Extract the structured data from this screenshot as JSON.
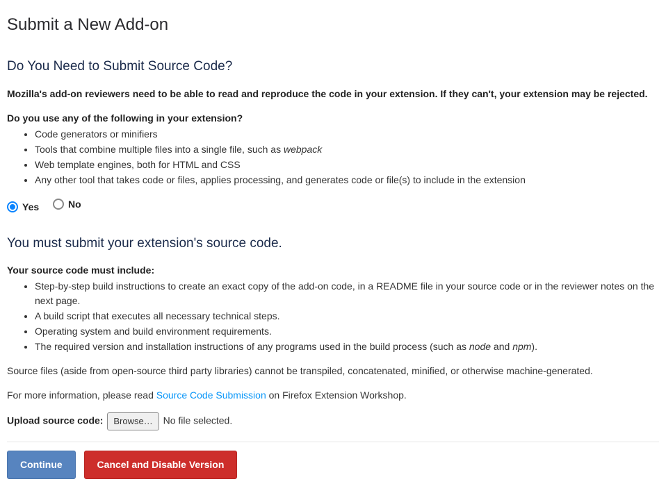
{
  "page_title": "Submit a New Add-on",
  "section1": {
    "heading": "Do You Need to Submit Source Code?",
    "intro": "Mozilla's add-on reviewers need to be able to read and reproduce the code in your extension. If they can't, your extension may be rejected.",
    "question": "Do you use any of the following in your extension?",
    "items": [
      "Code generators or minifiers",
      "Tools that combine multiple files into a single file, such as ",
      "Web template engines, both for HTML and CSS",
      "Any other tool that takes code or files, applies processing, and generates code or file(s) to include in the extension"
    ],
    "item1_em": "webpack"
  },
  "radio": {
    "yes": "Yes",
    "no": "No"
  },
  "section2": {
    "heading": "You must submit your extension's source code.",
    "must_include": "Your source code must include:",
    "items": [
      "Step-by-step build instructions to create an exact copy of the add-on code, in a README file in your source code or in the reviewer notes on the next page.",
      "A build script that executes all necessary technical steps.",
      "Operating system and build environment requirements."
    ],
    "item4_prefix": "The required version and installation instructions of any programs used in the build process (such as ",
    "item4_em1": "node",
    "item4_mid": " and ",
    "item4_em2": "npm",
    "item4_suffix": ").",
    "note": "Source files (aside from open-source third party libraries) cannot be transpiled, concatenated, minified, or otherwise machine-generated.",
    "more_info_prefix": "For more information, please read ",
    "more_info_link": "Source Code Submission",
    "more_info_suffix": " on Firefox Extension Workshop."
  },
  "upload": {
    "label": "Upload source code:",
    "browse": "Browse…",
    "status": "No file selected."
  },
  "buttons": {
    "continue": "Continue",
    "cancel": "Cancel and Disable Version"
  }
}
